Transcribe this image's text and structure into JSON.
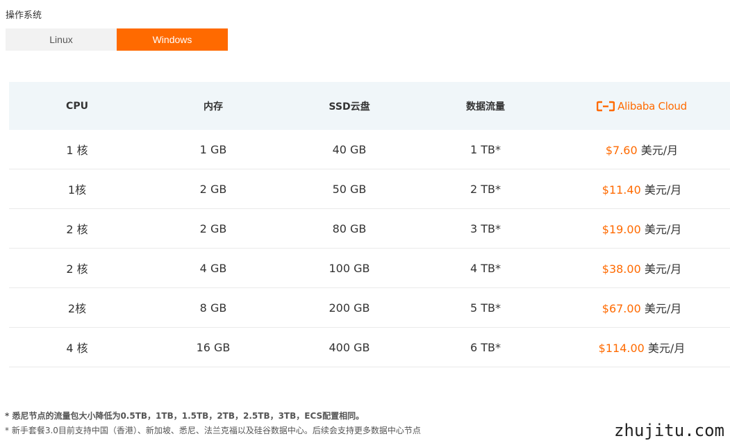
{
  "os": {
    "label": "操作系统",
    "tabs": [
      {
        "label": "Linux",
        "active": false
      },
      {
        "label": "Windows",
        "active": true
      }
    ],
    "active_color": "#ff6a00"
  },
  "table": {
    "headers": {
      "cpu": "CPU",
      "memory": "内存",
      "ssd": "SSD云盘",
      "traffic": "数据流量",
      "brand_logo": "Alibaba Cloud"
    },
    "rows": [
      {
        "cpu": "1 核",
        "memory": "1 GB",
        "ssd": "40 GB",
        "traffic": "1 TB*",
        "price": "$7.60",
        "unit": " 美元/月"
      },
      {
        "cpu": "1核",
        "memory": "2 GB",
        "ssd": "50 GB",
        "traffic": "2 TB*",
        "price": "$11.40",
        "unit": " 美元/月"
      },
      {
        "cpu": "2 核",
        "memory": "2 GB",
        "ssd": "80 GB",
        "traffic": "3 TB*",
        "price": "$19.00",
        "unit": " 美元/月"
      },
      {
        "cpu": "2 核",
        "memory": "4 GB",
        "ssd": "100 GB",
        "traffic": "4 TB*",
        "price": "$38.00",
        "unit": " 美元/月"
      },
      {
        "cpu": "2核",
        "memory": "8 GB",
        "ssd": "200 GB",
        "traffic": "5 TB*",
        "price": "$67.00",
        "unit": " 美元/月"
      },
      {
        "cpu": "4 核",
        "memory": "16 GB",
        "ssd": "400 GB",
        "traffic": "6 TB*",
        "price": "$114.00",
        "unit": " 美元/月"
      }
    ],
    "price_color": "#ff6a00",
    "header_bg": "#f0f6f9"
  },
  "notes": {
    "note1": "* 悉尼节点的流量包大小降低为0.5TB，1TB，1.5TB，2TB，2.5TB，3TB，ECS配置相同。",
    "note2": "* 新手套餐3.0目前支持中国（香港）、新加坡、悉尼、法兰克福以及硅谷数据中心。后续会支持更多数据中心节点"
  },
  "watermark": "zhujitu.com"
}
